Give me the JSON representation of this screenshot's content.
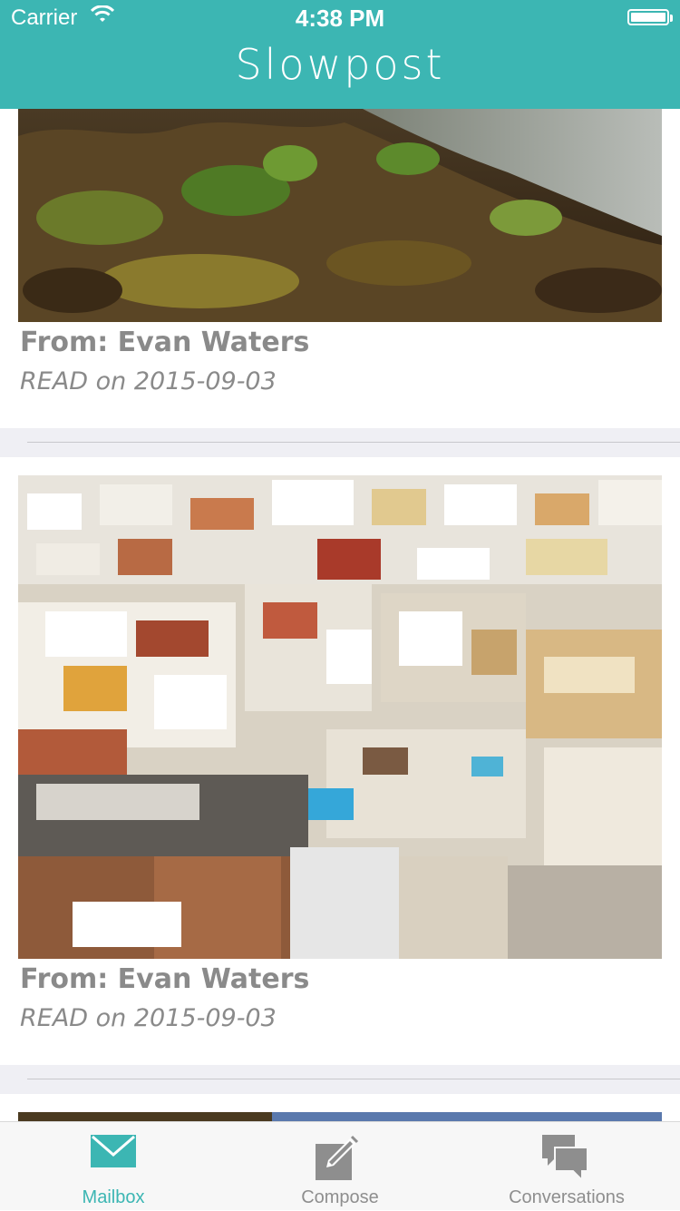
{
  "status_bar": {
    "carrier": "Carrier",
    "time": "4:38 PM"
  },
  "nav": {
    "title": "Slowpost"
  },
  "letters": [
    {
      "from": "From: Evan Waters",
      "status": "READ on 2015-09-03",
      "photo": "rocky coastal cliff with green plants"
    },
    {
      "from": "From: Evan Waters",
      "status": "READ on 2015-09-03",
      "photo": "aerial view of white city rooftops"
    },
    {
      "photo": "partially visible landscape photo"
    }
  ],
  "tabs": [
    {
      "label": "Mailbox",
      "icon": "envelope-icon",
      "active": true
    },
    {
      "label": "Compose",
      "icon": "compose-pencil-icon",
      "active": false
    },
    {
      "label": "Conversations",
      "icon": "chat-bubbles-icon",
      "active": false
    }
  ],
  "colors": {
    "brand": "#3cb6b3",
    "text_secondary": "#8a8a8a",
    "tab_inactive": "#8e8e8e",
    "separator_bg": "#efeff4"
  }
}
